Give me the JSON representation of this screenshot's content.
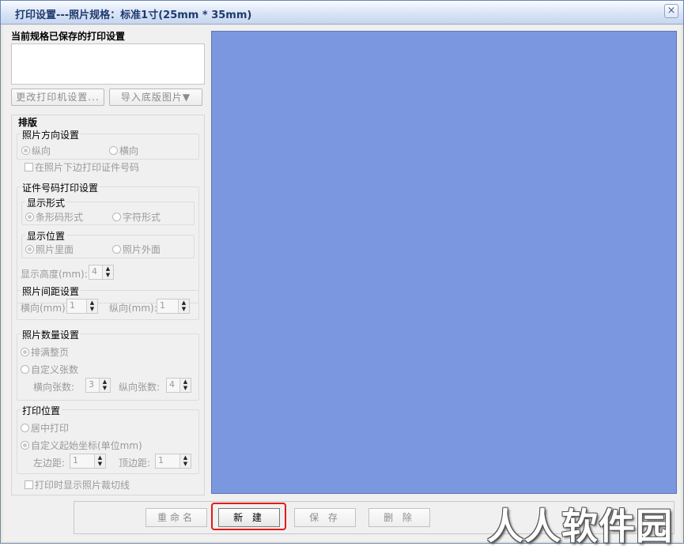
{
  "window": {
    "title": "打印设置---照片规格：标准1寸(25mm * 35mm)",
    "close_icon": "×"
  },
  "left": {
    "saved_label": "当前规格已保存的打印设置",
    "change_printer_button": "更改打印机设置...",
    "import_bg_button": "导入底版图片▼",
    "layout_title": "排版",
    "orientation": {
      "title": "照片方向设置",
      "portrait": "纵向",
      "landscape": "横向"
    },
    "print_id_under_photo": "在照片下边打印证件号码",
    "id_print": {
      "title": "证件号码打印设置",
      "display_form_title": "显示形式",
      "barcode": "条形码形式",
      "text_form": "字符形式",
      "display_pos_title": "显示位置",
      "inside": "照片里面",
      "outside": "照片外面",
      "height_label": "显示高度(mm):",
      "height_value": "4"
    },
    "spacing": {
      "title": "照片间距设置",
      "h_label": "横向(mm):",
      "h_value": "1",
      "v_label": "纵向(mm):",
      "v_value": "1"
    },
    "count": {
      "title": "照片数量设置",
      "fill_page": "排满整页",
      "custom": "自定义张数",
      "h_label": "横向张数:",
      "h_value": "3",
      "v_label": "纵向张数:",
      "v_value": "4"
    },
    "position": {
      "title": "打印位置",
      "center": "居中打印",
      "custom": "自定义起始坐标(单位mm)",
      "left_label": "左边距:",
      "left_value": "1",
      "top_label": "顶边距:",
      "top_value": "1"
    },
    "show_cut_lines": "打印时显示照片裁切线"
  },
  "bottom": {
    "rename": "重命名",
    "new": "新 建",
    "save": "保 存",
    "delete": "删 除"
  },
  "watermark": "人人软件园",
  "colors": {
    "preview": "#7b97e0",
    "highlight": "#e01b1b"
  }
}
